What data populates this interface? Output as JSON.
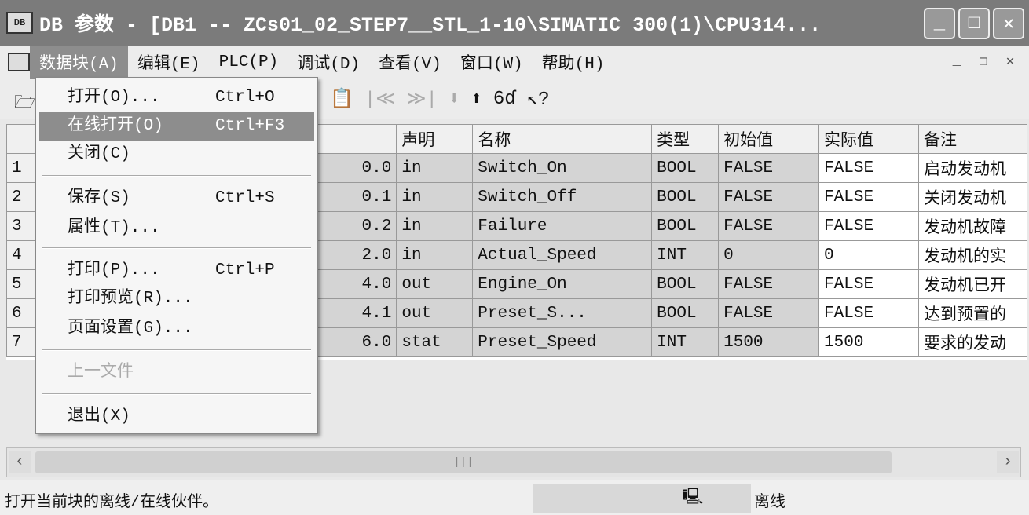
{
  "title": "DB 参数 - [DB1 -- ZCs01_02_STEP7__STL_1-10\\SIMATIC 300(1)\\CPU314...",
  "menu": [
    "数据块(A)",
    "编辑(E)",
    "PLC(P)",
    "调试(D)",
    "查看(V)",
    "窗口(W)",
    "帮助(H)"
  ],
  "dropdown": [
    {
      "label": "打开(O)...",
      "shortcut": "Ctrl+O"
    },
    {
      "label": "在线打开(O)",
      "shortcut": "Ctrl+F3"
    },
    {
      "label": "关闭(C)",
      "shortcut": ""
    },
    {
      "label": "保存(S)",
      "shortcut": "Ctrl+S"
    },
    {
      "label": "属性(T)...",
      "shortcut": ""
    },
    {
      "label": "打印(P)...",
      "shortcut": "Ctrl+P"
    },
    {
      "label": "打印预览(R)...",
      "shortcut": ""
    },
    {
      "label": "页面设置(G)...",
      "shortcut": ""
    },
    {
      "label": "上一文件",
      "shortcut": ""
    },
    {
      "label": "退出(X)",
      "shortcut": ""
    }
  ],
  "table": {
    "headers": [
      "声明",
      "名称",
      "类型",
      "初始值",
      "实际值",
      "备注"
    ],
    "rows": [
      [
        "1",
        "0.0",
        "in",
        "Switch_On",
        "BOOL",
        "FALSE",
        "FALSE",
        "启动发动机"
      ],
      [
        "2",
        "0.1",
        "in",
        "Switch_Off",
        "BOOL",
        "FALSE",
        "FALSE",
        "关闭发动机"
      ],
      [
        "3",
        "0.2",
        "in",
        "Failure",
        "BOOL",
        "FALSE",
        "FALSE",
        "发动机故障"
      ],
      [
        "4",
        "2.0",
        "in",
        "Actual_Speed",
        "INT",
        "0",
        "0",
        "发动机的实"
      ],
      [
        "5",
        "4.0",
        "out",
        "Engine_On",
        "BOOL",
        "FALSE",
        "FALSE",
        "发动机已开"
      ],
      [
        "6",
        "4.1",
        "out",
        "Preset_S...",
        "BOOL",
        "FALSE",
        "FALSE",
        "达到预置的"
      ],
      [
        "7",
        "6.0",
        "stat",
        "Preset_Speed",
        "INT",
        "1500",
        "1500",
        "要求的发动"
      ]
    ]
  },
  "status": {
    "message": "打开当前块的离线/在线伙伴。",
    "mode": "离线"
  }
}
